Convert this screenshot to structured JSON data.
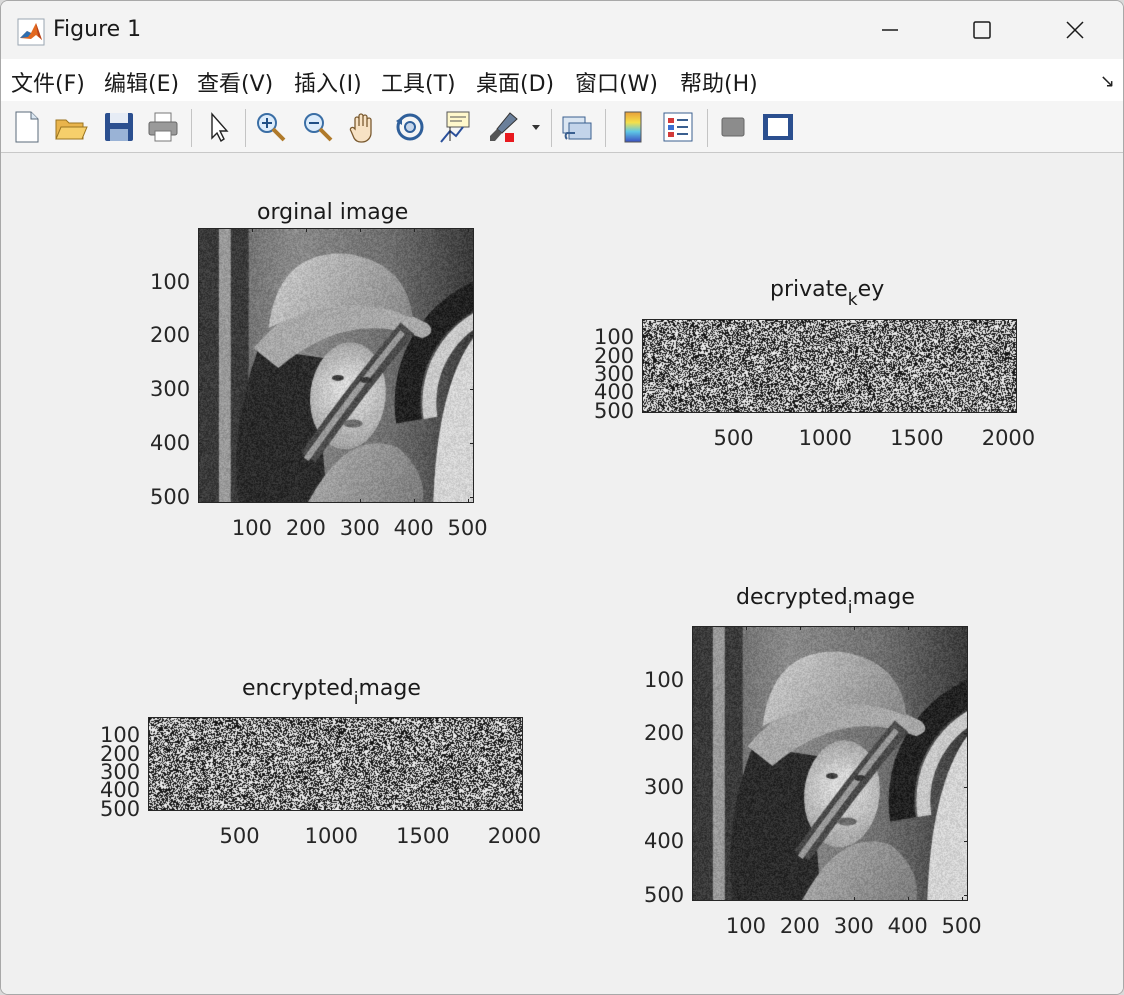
{
  "window": {
    "title": "Figure 1"
  },
  "menu": [
    {
      "label": "文件(F)"
    },
    {
      "label": "编辑(E)"
    },
    {
      "label": "查看(V)"
    },
    {
      "label": "插入(I)"
    },
    {
      "label": "工具(T)"
    },
    {
      "label": "桌面(D)"
    },
    {
      "label": "窗口(W)"
    },
    {
      "label": "帮助(H)"
    }
  ],
  "toolbar_icons": [
    "new-figure-icon",
    "open-file-icon",
    "save-icon",
    "print-icon",
    "edit-plot-arrow-icon",
    "zoom-in-icon",
    "zoom-out-icon",
    "pan-hand-icon",
    "rotate-3d-icon",
    "data-cursor-icon",
    "brush-icon",
    "link-plot-icon",
    "colorbar-icon",
    "legend-icon",
    "hide-plot-tools-icon",
    "show-plot-tools-icon"
  ],
  "colors": {
    "window_bg": "#f0f0f0",
    "axes_line": "#262626"
  },
  "chart_data": [
    {
      "type": "image",
      "title": "orginal image",
      "content": "grayscale portrait photo",
      "xticks": [
        "100",
        "200",
        "300",
        "400",
        "500"
      ],
      "yticks": [
        "100",
        "200",
        "300",
        "400",
        "500"
      ],
      "xlim": [
        0,
        512
      ],
      "ylim": [
        0,
        512
      ]
    },
    {
      "type": "image",
      "title": "private",
      "title_sub": "k",
      "title_rest": "ey",
      "content": "random binary noise",
      "xticks": [
        "500",
        "1000",
        "1500",
        "2000"
      ],
      "yticks": [
        "100",
        "200",
        "300",
        "400",
        "500"
      ],
      "xlim": [
        0,
        2048
      ],
      "ylim": [
        0,
        512
      ]
    },
    {
      "type": "image",
      "title": "encrypted",
      "title_sub": "i",
      "title_rest": "mage",
      "content": "random binary noise",
      "xticks": [
        "500",
        "1000",
        "1500",
        "2000"
      ],
      "yticks": [
        "100",
        "200",
        "300",
        "400",
        "500"
      ],
      "xlim": [
        0,
        2048
      ],
      "ylim": [
        0,
        512
      ]
    },
    {
      "type": "image",
      "title": "decrypted",
      "title_sub": "i",
      "title_rest": "mage",
      "content": "grayscale portrait photo",
      "xticks": [
        "100",
        "200",
        "300",
        "400",
        "500"
      ],
      "yticks": [
        "100",
        "200",
        "300",
        "400",
        "500"
      ],
      "xlim": [
        0,
        512
      ],
      "ylim": [
        0,
        512
      ]
    }
  ]
}
